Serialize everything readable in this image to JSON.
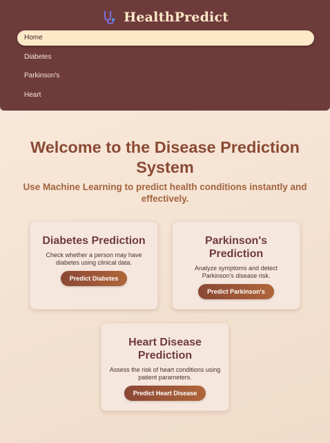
{
  "brand": {
    "name": "HealthPredict",
    "icon": "stethoscope-icon"
  },
  "nav": {
    "items": [
      {
        "label": "Home",
        "active": true
      },
      {
        "label": "Diabetes",
        "active": false
      },
      {
        "label": "Parkinson's",
        "active": false
      },
      {
        "label": "Heart",
        "active": false
      }
    ]
  },
  "hero": {
    "title": "Welcome to the Disease Prediction System",
    "subtitle": "Use Machine Learning to predict health conditions instantly and effectively."
  },
  "cards": [
    {
      "title": "Diabetes Prediction",
      "description": "Check whether a person may have diabetes using clinical data.",
      "button": "Predict Diabetes"
    },
    {
      "title": "Parkinson's Prediction",
      "description": "Analyze symptoms and detect Parkinson's disease risk.",
      "button": "Predict Parkinson's"
    },
    {
      "title": "Heart Disease Prediction",
      "description": "Assess the risk of heart conditions using patient parameters.",
      "button": "Predict Heart Disease"
    }
  ],
  "colors": {
    "navbar": "#6e3b3b",
    "accent": "#fde9c8",
    "heading": "#8a4a35",
    "button": "#a05a38"
  }
}
